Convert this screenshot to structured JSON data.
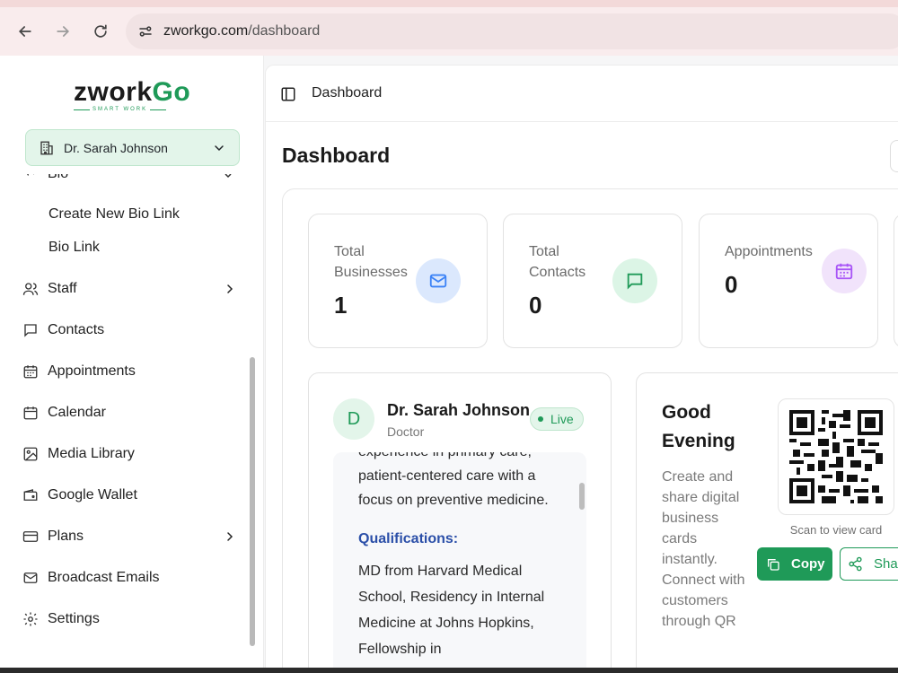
{
  "browser": {
    "url_host": "zworkgo.com",
    "url_path": "/dashboard"
  },
  "logo": {
    "name_main": "zwork",
    "name_accent": "Go",
    "tagline": "SMART WORK"
  },
  "business_selector": {
    "value": "Dr. Sarah Johnson"
  },
  "sidebar": {
    "partial_item": "Bio Link",
    "sub_items": [
      {
        "label": "Create New Bio Link"
      },
      {
        "label": "Bio Link"
      }
    ],
    "items": [
      {
        "label": "Staff",
        "icon": "users-icon"
      },
      {
        "label": "Contacts",
        "icon": "message-icon"
      },
      {
        "label": "Appointments",
        "icon": "calendar-check-icon"
      },
      {
        "label": "Calendar",
        "icon": "calendar-icon"
      },
      {
        "label": "Media Library",
        "icon": "image-icon"
      },
      {
        "label": "Google Wallet",
        "icon": "wallet-icon"
      },
      {
        "label": "Plans",
        "icon": "credit-card-icon"
      },
      {
        "label": "Broadcast Emails",
        "icon": "mail-icon"
      },
      {
        "label": "Settings",
        "icon": "gear-icon"
      }
    ]
  },
  "header": {
    "breadcrumb": "Dashboard",
    "title": "Dashboard"
  },
  "stats": [
    {
      "label": "Total Businesses",
      "value": "1",
      "icon": "mail-icon",
      "color": "#3b82f6"
    },
    {
      "label": "Total Contacts",
      "value": "0",
      "icon": "message-icon",
      "color": "#1f9a58"
    },
    {
      "label": "Appointments",
      "value": "0",
      "icon": "calendar-icon",
      "color": "#a855f7"
    }
  ],
  "profile": {
    "avatar_letter": "D",
    "name": "Dr. Sarah Johnson",
    "role": "Doctor",
    "status": "Live",
    "bio_cut": "experience in primary care,",
    "bio": "patient-centered care with a focus on preventive medicine.",
    "qualifications_heading": "Qualifications:",
    "qualifications": "MD from Harvard Medical School, Residency in Internal Medicine at Johns Hopkins, Fellowship in"
  },
  "greeting": {
    "title": "Good Evening",
    "description": "Create and share digital business cards instantly. Connect with customers through QR",
    "qr_caption": "Scan to view card",
    "copy_label": "Copy",
    "share_label": "Share"
  },
  "colors": {
    "accent": "#1f9a58",
    "qualifications_heading": "#2b4fa8"
  }
}
